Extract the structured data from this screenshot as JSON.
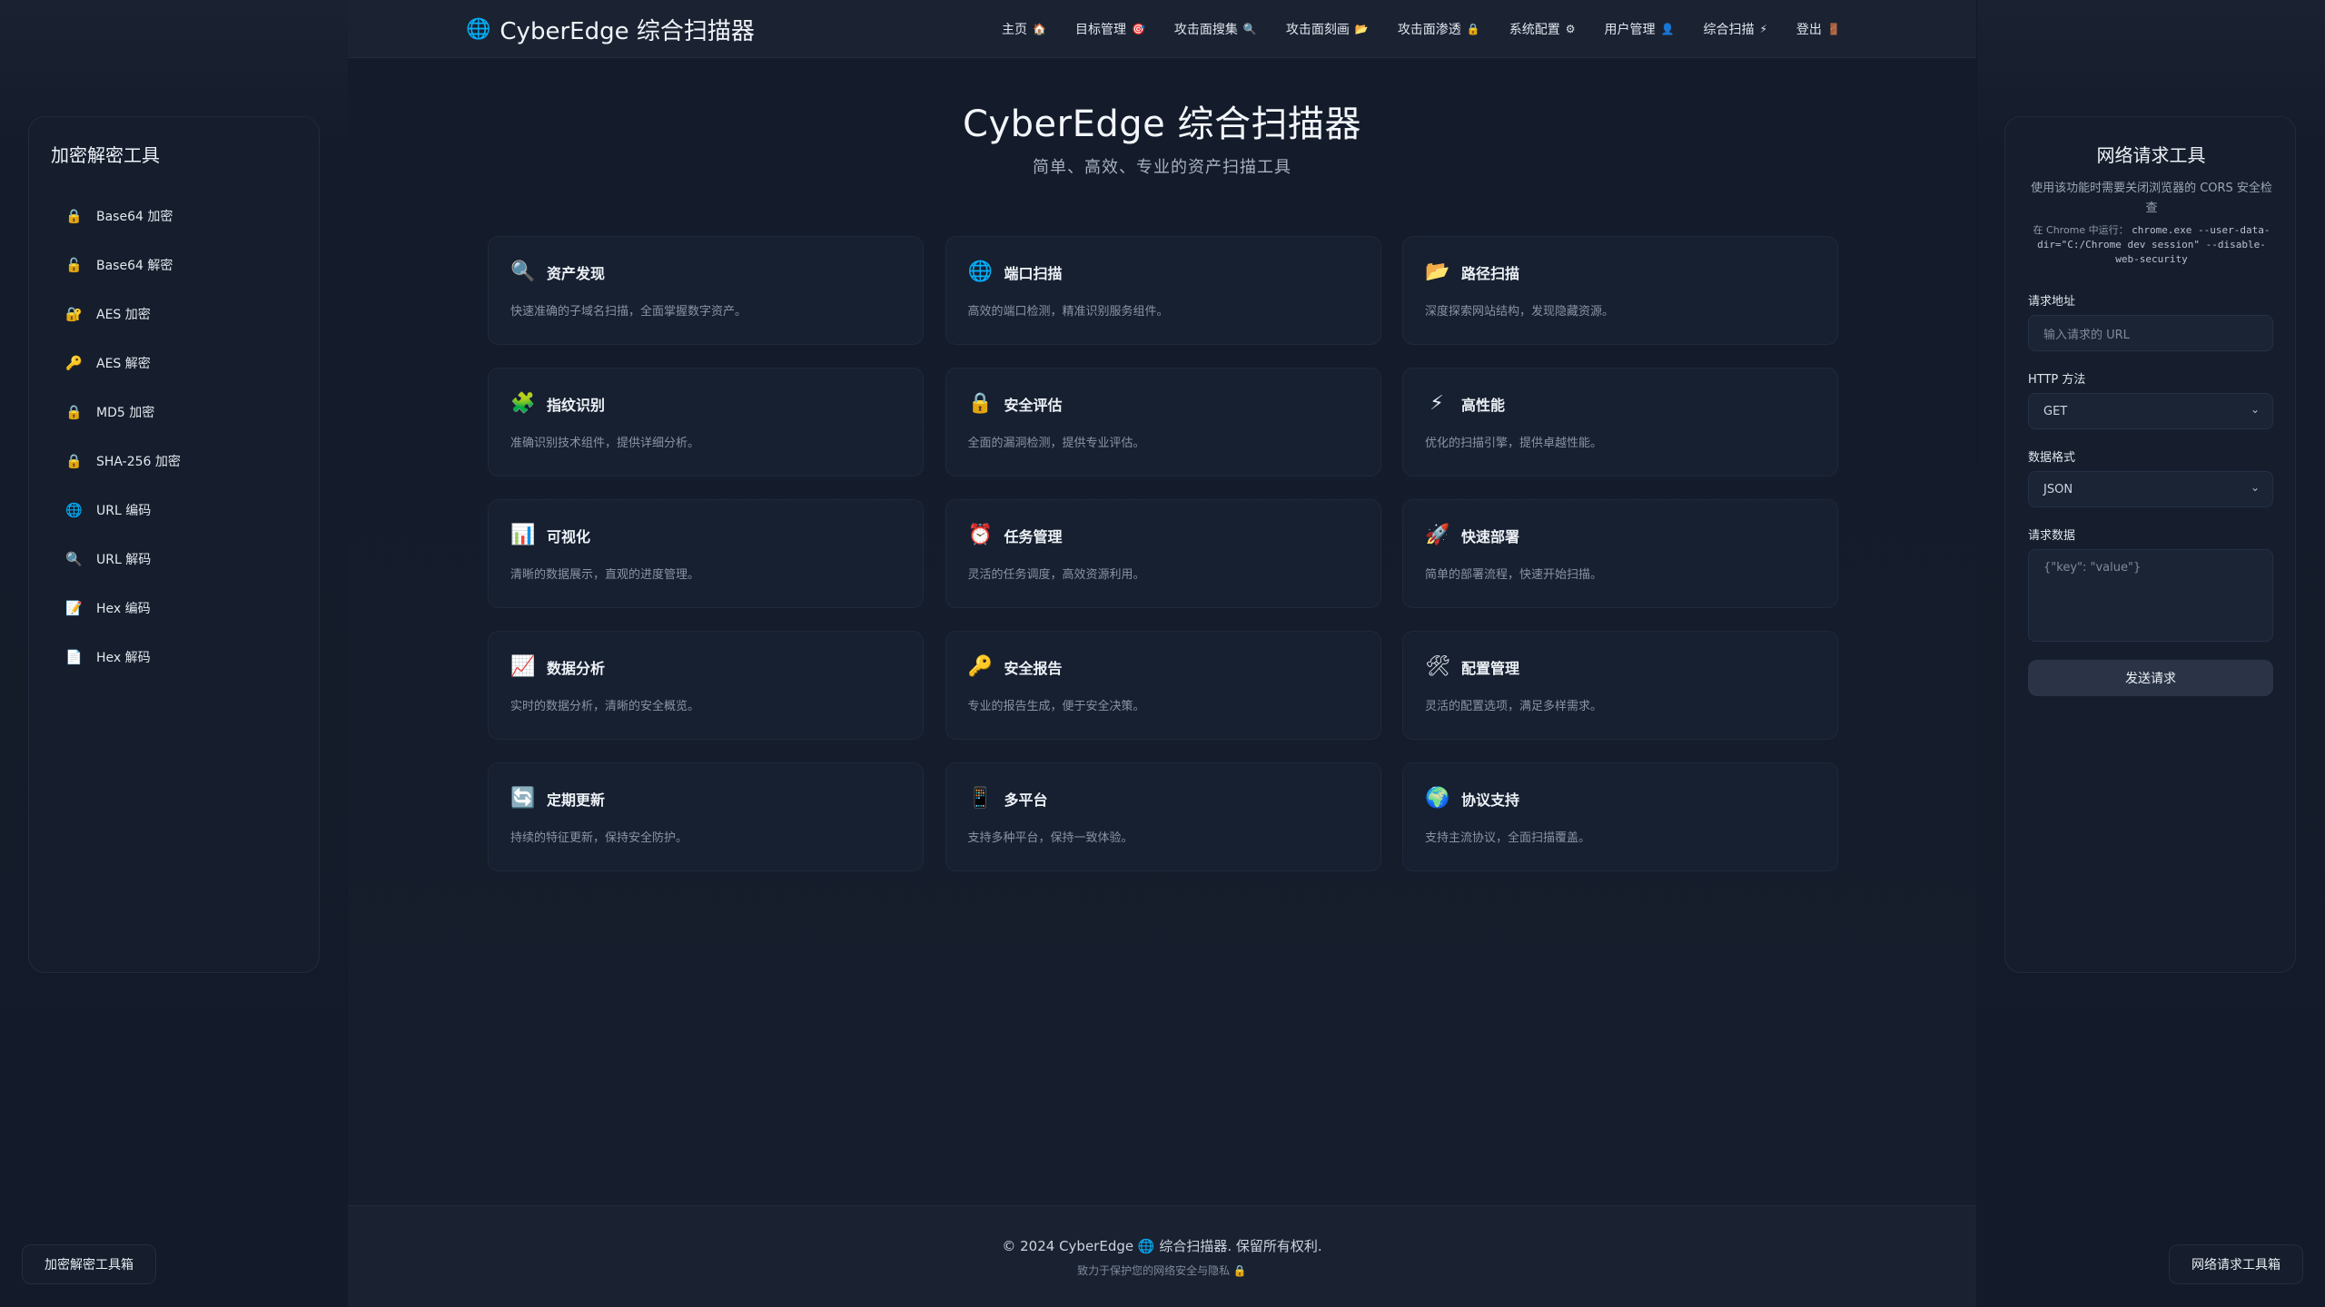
{
  "header": {
    "brand": "CyberEdge 综合扫描器",
    "brand_icon": "🌐",
    "nav": [
      {
        "label": "主页",
        "icon": "🏠"
      },
      {
        "label": "目标管理",
        "icon": "🎯"
      },
      {
        "label": "攻击面搜集",
        "icon": "🔍"
      },
      {
        "label": "攻击面刻画",
        "icon": "📂"
      },
      {
        "label": "攻击面渗透",
        "icon": "🔒"
      },
      {
        "label": "系统配置",
        "icon": "⚙"
      },
      {
        "label": "用户管理",
        "icon": "👤"
      },
      {
        "label": "综合扫描",
        "icon": "⚡"
      },
      {
        "label": "登出",
        "icon": "🚪"
      }
    ]
  },
  "hero": {
    "title": "CyberEdge 综合扫描器",
    "subtitle": "简单、高效、专业的资产扫描工具"
  },
  "features": [
    {
      "icon": "🔍",
      "title": "资产发现",
      "desc": "快速准确的子域名扫描，全面掌握数字资产。"
    },
    {
      "icon": "🌐",
      "title": "端口扫描",
      "desc": "高效的端口检测，精准识别服务组件。"
    },
    {
      "icon": "📂",
      "title": "路径扫描",
      "desc": "深度探索网站结构，发现隐藏资源。"
    },
    {
      "icon": "🧩",
      "title": "指纹识别",
      "desc": "准确识别技术组件，提供详细分析。"
    },
    {
      "icon": "🔒",
      "title": "安全评估",
      "desc": "全面的漏洞检测，提供专业评估。"
    },
    {
      "icon": "⚡",
      "title": "高性能",
      "desc": "优化的扫描引擎，提供卓越性能。"
    },
    {
      "icon": "📊",
      "title": "可视化",
      "desc": "清晰的数据展示，直观的进度管理。"
    },
    {
      "icon": "⏰",
      "title": "任务管理",
      "desc": "灵活的任务调度，高效资源利用。"
    },
    {
      "icon": "🚀",
      "title": "快速部署",
      "desc": "简单的部署流程，快速开始扫描。"
    },
    {
      "icon": "📈",
      "title": "数据分析",
      "desc": "实时的数据分析，清晰的安全概览。"
    },
    {
      "icon": "🔑",
      "title": "安全报告",
      "desc": "专业的报告生成，便于安全决策。"
    },
    {
      "icon": "🛠",
      "title": "配置管理",
      "desc": "灵活的配置选项，满足多样需求。"
    },
    {
      "icon": "🔄",
      "title": "定期更新",
      "desc": "持续的特征更新，保持安全防护。"
    },
    {
      "icon": "📱",
      "title": "多平台",
      "desc": "支持多种平台，保持一致体验。"
    },
    {
      "icon": "🌍",
      "title": "协议支持",
      "desc": "支持主流协议，全面扫描覆盖。"
    }
  ],
  "crypto_panel": {
    "title": "加密解密工具",
    "tools": [
      {
        "icon": "🔒",
        "label": "Base64 加密"
      },
      {
        "icon": "🔓",
        "label": "Base64 解密"
      },
      {
        "icon": "🔐",
        "label": "AES 加密"
      },
      {
        "icon": "🔑",
        "label": "AES 解密"
      },
      {
        "icon": "🔒",
        "label": "MD5 加密"
      },
      {
        "icon": "🔒",
        "label": "SHA-256 加密"
      },
      {
        "icon": "🌐",
        "label": "URL 编码"
      },
      {
        "icon": "🔍",
        "label": "URL 解码"
      },
      {
        "icon": "📝",
        "label": "Hex 编码"
      },
      {
        "icon": "📄",
        "label": "Hex 解码"
      }
    ]
  },
  "request_panel": {
    "title": "网络请求工具",
    "note": "使用该功能时需要关闭浏览器的 CORS 安全检查",
    "cmd_prefix": "在 Chrome 中运行：",
    "cmd": "chrome.exe --user-data-dir=\"C:/Chrome dev session\" --disable-web-security",
    "url_label": "请求地址",
    "url_placeholder": "输入请求的 URL",
    "method_label": "HTTP 方法",
    "method_value": "GET",
    "format_label": "数据格式",
    "format_value": "JSON",
    "body_label": "请求数据",
    "body_placeholder": "{\"key\": \"value\"}",
    "send_label": "发送请求"
  },
  "footer": {
    "copyright": "© 2024 CyberEdge 🌐 综合扫描器. 保留所有权利.",
    "tagline": "致力于保护您的网络安全与隐私 🔒"
  },
  "corner": {
    "left_label": "加密解密工具箱",
    "right_label": "网络请求工具箱"
  }
}
